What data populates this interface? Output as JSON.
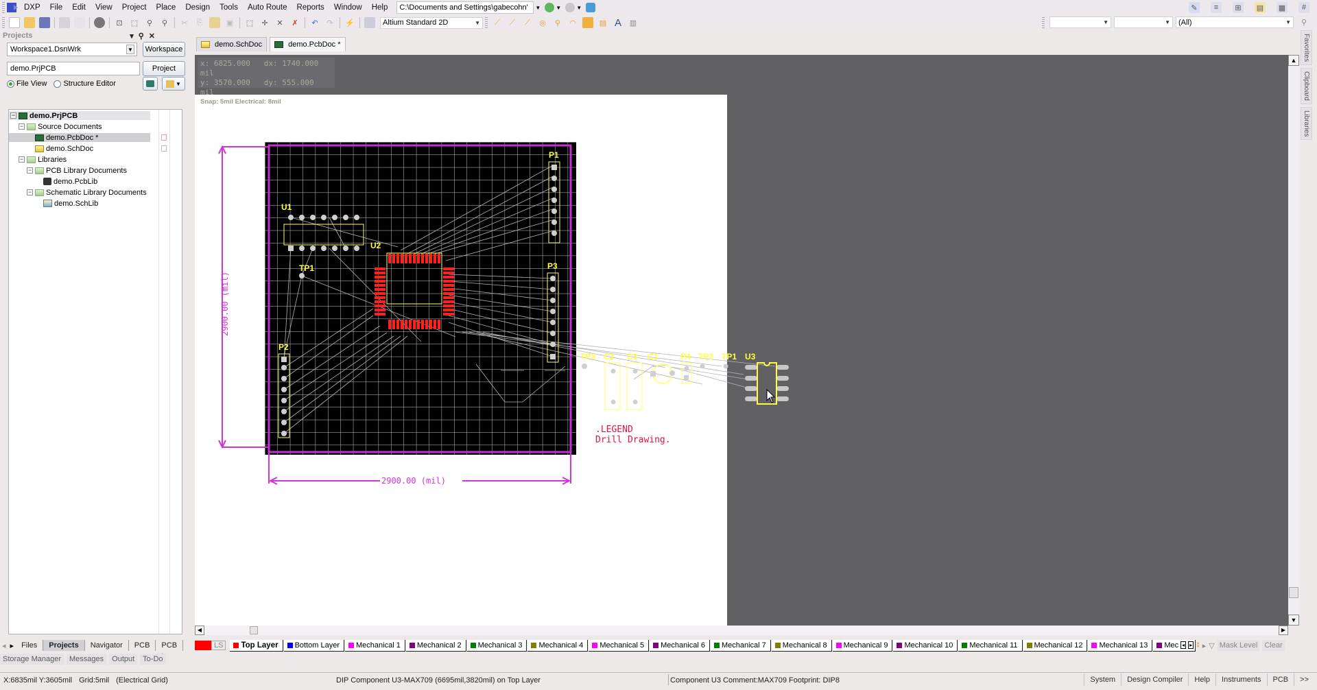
{
  "app": {
    "menu": [
      "DXP",
      "File",
      "Edit",
      "View",
      "Project",
      "Place",
      "Design",
      "Tools",
      "Auto Route",
      "Reports",
      "Window",
      "Help"
    ],
    "path": "C:\\Documents and Settings\\gabecohn'",
    "view_mode": "Altium Standard 2D",
    "filter_combo_1": "",
    "filter_combo_2": "",
    "filter_combo_3": "(All)"
  },
  "projects_panel": {
    "title": "Projects",
    "workspace_value": "Workspace1.DsnWrk",
    "workspace_button": "Workspace",
    "project_value": "demo.PrjPCB",
    "project_button": "Project",
    "view_options": [
      {
        "label": "File View",
        "selected": true
      },
      {
        "label": "Structure Editor",
        "selected": false
      }
    ],
    "tree": [
      {
        "label": "demo.PrjPCB",
        "icon": "pcb-project-icon",
        "level": 0
      },
      {
        "label": "Source Documents",
        "icon": "folder-icon",
        "level": 1
      },
      {
        "label": "demo.PcbDoc *",
        "icon": "pcb-doc-icon",
        "level": 2,
        "selected": true
      },
      {
        "label": "demo.SchDoc",
        "icon": "sch-doc-icon",
        "level": 2
      },
      {
        "label": "Libraries",
        "icon": "folder-icon",
        "level": 1
      },
      {
        "label": "PCB Library Documents",
        "icon": "folder-icon",
        "level": 2
      },
      {
        "label": "demo.PcbLib",
        "icon": "pcb-lib-icon",
        "level": 3
      },
      {
        "label": "Schematic Library Documents",
        "icon": "folder-icon",
        "level": 2
      },
      {
        "label": "demo.SchLib",
        "icon": "sch-lib-icon",
        "level": 3
      }
    ]
  },
  "panel_tabs": [
    "Files",
    "Projects",
    "Navigator",
    "PCB",
    "PCB I"
  ],
  "panel_tabs_active": "Projects",
  "bottom_panels": [
    "Storage Manager",
    "Messages",
    "Output",
    "To-Do"
  ],
  "doc_tabs": [
    {
      "label": "demo.SchDoc",
      "icon": "sch-doc-icon",
      "active": false
    },
    {
      "label": "demo.PcbDoc *",
      "icon": "pcb-doc-icon",
      "active": true
    }
  ],
  "hud": {
    "x": "x:  6825.000",
    "dx": "dx:  1740.000  mil",
    "y": "y:  3570.000",
    "dy": "dy:   555.000  mil",
    "snap": "Snap: 5mil Electrical: 8mil"
  },
  "pcb": {
    "designators": [
      "U1",
      "U2",
      "TP1",
      "P1",
      "P2",
      "P3",
      "TP3",
      "C2",
      "C3",
      "C1",
      "P4",
      "TP2",
      "TP1",
      "U3"
    ],
    "dimension_horizontal": "2900.00 (mil)",
    "dimension_vertical": "2900.00 (mil)",
    "legend_line1": ".LEGEND",
    "legend_line2": "Drill Drawing."
  },
  "layer_tabs": {
    "ls_label": "LS",
    "tabs": [
      {
        "label": "Top Layer",
        "color": "#ff0000",
        "active": true
      },
      {
        "label": "Bottom Layer",
        "color": "#0000ff"
      },
      {
        "label": "Mechanical 1",
        "color": "#ff00ff"
      },
      {
        "label": "Mechanical 2",
        "color": "#800080"
      },
      {
        "label": "Mechanical 3",
        "color": "#008000"
      },
      {
        "label": "Mechanical 4",
        "color": "#808000"
      },
      {
        "label": "Mechanical 5",
        "color": "#ff00ff"
      },
      {
        "label": "Mechanical 6",
        "color": "#800080"
      },
      {
        "label": "Mechanical 7",
        "color": "#008000"
      },
      {
        "label": "Mechanical 8",
        "color": "#808000"
      },
      {
        "label": "Mechanical 9",
        "color": "#ff00ff"
      },
      {
        "label": "Mechanical 10",
        "color": "#800080"
      },
      {
        "label": "Mechanical 11",
        "color": "#008000"
      },
      {
        "label": "Mechanical 12",
        "color": "#808000"
      },
      {
        "label": "Mechanical 13",
        "color": "#ff00ff"
      },
      {
        "label": "Mec",
        "color": "#800080"
      }
    ],
    "mask_level": "Mask Level",
    "clear": "Clear"
  },
  "right_dock": [
    "Favorites",
    "Clipboard",
    "Libraries"
  ],
  "status": {
    "coords": "X:6835mil Y:3605mil",
    "grid": "Grid:5mil",
    "grid_type": "(Electrical Grid)",
    "hover_info": "DIP Component U3-MAX709 (6695mil,3820mil) on Top Layer",
    "component_info": "Component U3 Comment:MAX709 Footprint: DIP8",
    "buttons": [
      "System",
      "Design Compiler",
      "Help",
      "Instruments",
      "PCB",
      ">>"
    ]
  }
}
